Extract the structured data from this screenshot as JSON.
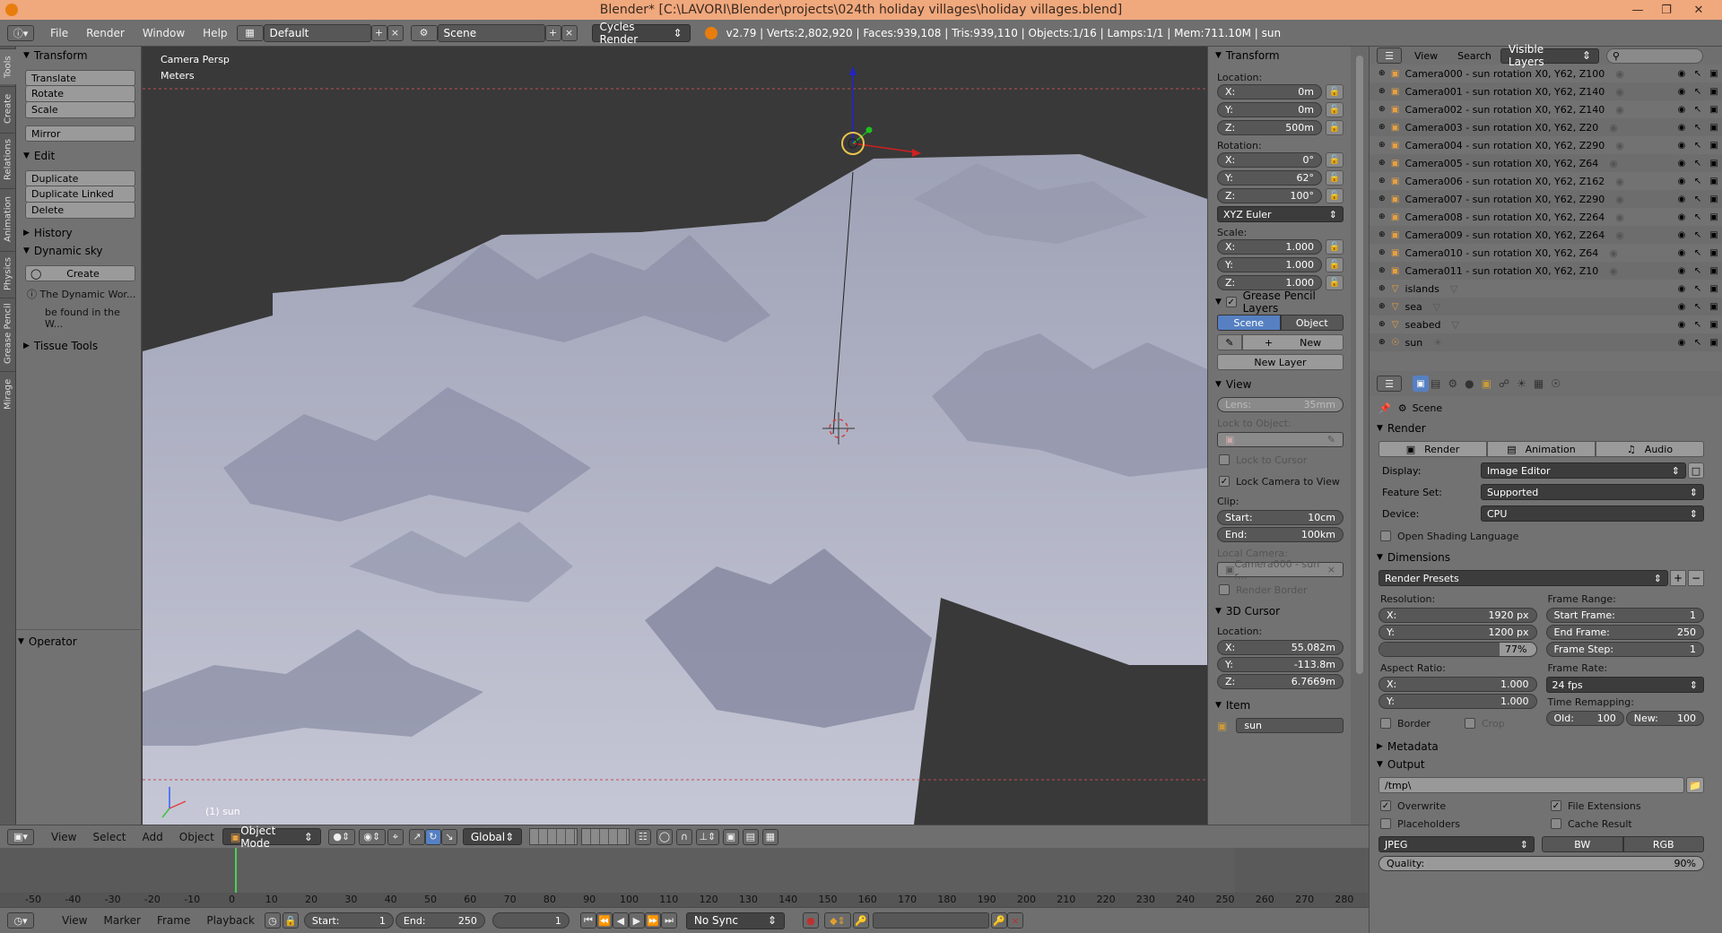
{
  "window": {
    "title": "Blender* [C:\\LAVORI\\Blender\\projects\\024th holiday villages\\holiday villages.blend]"
  },
  "menu": {
    "file": "File",
    "render": "Render",
    "window": "Window",
    "help": "Help"
  },
  "screen_layout": "Default",
  "scene_name": "Scene",
  "render_engine": "Cycles Render",
  "stats": "v2.79 | Verts:2,802,920 | Faces:939,108 | Tris:939,110 | Objects:1/16 | Lamps:1/1 | Mem:711.10M | sun",
  "side_tabs": [
    "Tools",
    "Create",
    "Relations",
    "Animation",
    "Physics",
    "Grease Pencil",
    "Mirage"
  ],
  "toolshelf": {
    "transform_header": "Transform",
    "translate": "Translate",
    "rotate": "Rotate",
    "scale": "Scale",
    "mirror": "Mirror",
    "edit_header": "Edit",
    "duplicate": "Duplicate",
    "duplicate_linked": "Duplicate Linked",
    "delete": "Delete",
    "history_header": "History",
    "dynamic_sky_header": "Dynamic sky",
    "create": "Create",
    "info_line1": "The Dynamic Wor...",
    "info_line2": "be found in the W...",
    "tissue_header": "Tissue Tools",
    "operator_header": "Operator"
  },
  "viewport": {
    "camera_label": "Camera Persp",
    "units_label": "Meters",
    "object_label": "(1) sun"
  },
  "npanel": {
    "transform": "Transform",
    "location": "Location:",
    "loc": [
      {
        "a": "X:",
        "v": "0m"
      },
      {
        "a": "Y:",
        "v": "0m"
      },
      {
        "a": "Z:",
        "v": "500m"
      }
    ],
    "rotation": "Rotation:",
    "rot": [
      {
        "a": "X:",
        "v": "0°"
      },
      {
        "a": "Y:",
        "v": "62°"
      },
      {
        "a": "Z:",
        "v": "100°"
      }
    ],
    "rot_mode": "XYZ Euler",
    "scale": "Scale:",
    "scl": [
      {
        "a": "X:",
        "v": "1.000"
      },
      {
        "a": "Y:",
        "v": "1.000"
      },
      {
        "a": "Z:",
        "v": "1.000"
      }
    ],
    "gp_layers": "Grease Pencil Layers",
    "gp_scene": "Scene",
    "gp_object": "Object",
    "gp_new": "New",
    "gp_new_layer": "New Layer",
    "view": "View",
    "lens_label": "Lens:",
    "lens_value": "35mm",
    "lock_to_object": "Lock to Object:",
    "lock_to_cursor": "Lock to Cursor",
    "lock_camera": "Lock Camera to View",
    "clip": "Clip:",
    "clip_start_label": "Start:",
    "clip_start": "10cm",
    "clip_end_label": "End:",
    "clip_end": "100km",
    "local_camera": "Local Camera:",
    "local_camera_value": "Camera000 - sun r...",
    "render_border": "Render Border",
    "cursor": "3D Cursor",
    "cursor_location": "Location:",
    "cur": [
      {
        "a": "X:",
        "v": "55.082m"
      },
      {
        "a": "Y:",
        "v": "-113.8m"
      },
      {
        "a": "Z:",
        "v": "6.7669m"
      }
    ],
    "item": "Item",
    "item_name": "sun"
  },
  "outliner": {
    "view": "View",
    "search": "Search",
    "filter": "Visible Layers",
    "items": [
      {
        "name": "Camera000 - sun rotation X0, Y62, Z100",
        "type": "camera"
      },
      {
        "name": "Camera001 - sun rotation X0, Y62, Z140",
        "type": "camera"
      },
      {
        "name": "Camera002 - sun rotation X0, Y62, Z140",
        "type": "camera"
      },
      {
        "name": "Camera003 - sun rotation X0, Y62, Z20",
        "type": "camera"
      },
      {
        "name": "Camera004 - sun rotation X0, Y62, Z290",
        "type": "camera"
      },
      {
        "name": "Camera005 - sun rotation X0, Y62, Z64",
        "type": "camera"
      },
      {
        "name": "Camera006 - sun rotation X0, Y62, Z162",
        "type": "camera"
      },
      {
        "name": "Camera007 - sun rotation X0, Y62, Z290",
        "type": "camera"
      },
      {
        "name": "Camera008 - sun rotation X0, Y62, Z264",
        "type": "camera"
      },
      {
        "name": "Camera009 - sun rotation X0, Y62, Z264",
        "type": "camera"
      },
      {
        "name": "Camera010 - sun rotation X0, Y62, Z64",
        "type": "camera"
      },
      {
        "name": "Camera011 - sun rotation X0, Y62, Z10",
        "type": "camera"
      },
      {
        "name": "islands",
        "type": "mesh"
      },
      {
        "name": "sea",
        "type": "mesh"
      },
      {
        "name": "seabed",
        "type": "mesh"
      },
      {
        "name": "sun",
        "type": "lamp"
      }
    ]
  },
  "properties": {
    "scene": "Scene",
    "render": "Render",
    "render_btn": "Render",
    "animation_btn": "Animation",
    "audio_btn": "Audio",
    "display_label": "Display:",
    "display": "Image Editor",
    "feature_label": "Feature Set:",
    "feature": "Supported",
    "device_label": "Device:",
    "device": "CPU",
    "osl": "Open Shading Language",
    "dimensions": "Dimensions",
    "render_presets": "Render Presets",
    "resolution": "Resolution:",
    "res_x": "X:",
    "res_x_val": "1920 px",
    "res_y": "Y:",
    "res_y_val": "1200 px",
    "res_pct": "77%",
    "frame_range": "Frame Range:",
    "start_frame": "Start Frame:",
    "start_frame_val": "1",
    "end_frame": "End Frame:",
    "end_frame_val": "250",
    "frame_step": "Frame Step:",
    "frame_step_val": "1",
    "aspect": "Aspect Ratio:",
    "asp_x": "X:",
    "asp_x_val": "1.000",
    "asp_y": "Y:",
    "asp_y_val": "1.000",
    "frame_rate": "Frame Rate:",
    "fps": "24 fps",
    "time_remap": "Time Remapping:",
    "old": "Old:",
    "old_val": "100",
    "new": "New:",
    "new_val": "100",
    "border": "Border",
    "crop": "Crop",
    "metadata": "Metadata",
    "output": "Output",
    "output_path": "/tmp\\",
    "overwrite": "Overwrite",
    "file_ext": "File Extensions",
    "placeholders": "Placeholders",
    "cache_result": "Cache Result",
    "format": "JPEG",
    "bw": "BW",
    "rgb": "RGB",
    "quality": "Quality:",
    "quality_val": "90%"
  },
  "view_header": {
    "view": "View",
    "select": "Select",
    "add": "Add",
    "object": "Object",
    "mode": "Object Mode",
    "orientation": "Global"
  },
  "timeline": {
    "ticks": [
      "-50",
      "-40",
      "-30",
      "-20",
      "-10",
      "0",
      "10",
      "20",
      "30",
      "40",
      "50",
      "60",
      "70",
      "80",
      "90",
      "100",
      "110",
      "120",
      "130",
      "140",
      "150",
      "160",
      "170",
      "180",
      "190",
      "200",
      "210",
      "220",
      "230",
      "240",
      "250",
      "260",
      "270",
      "280"
    ],
    "view": "View",
    "marker": "Marker",
    "frame": "Frame",
    "playback": "Playback",
    "start_label": "Start:",
    "start": "1",
    "end_label": "End:",
    "end": "250",
    "current": "1",
    "sync": "No Sync"
  }
}
